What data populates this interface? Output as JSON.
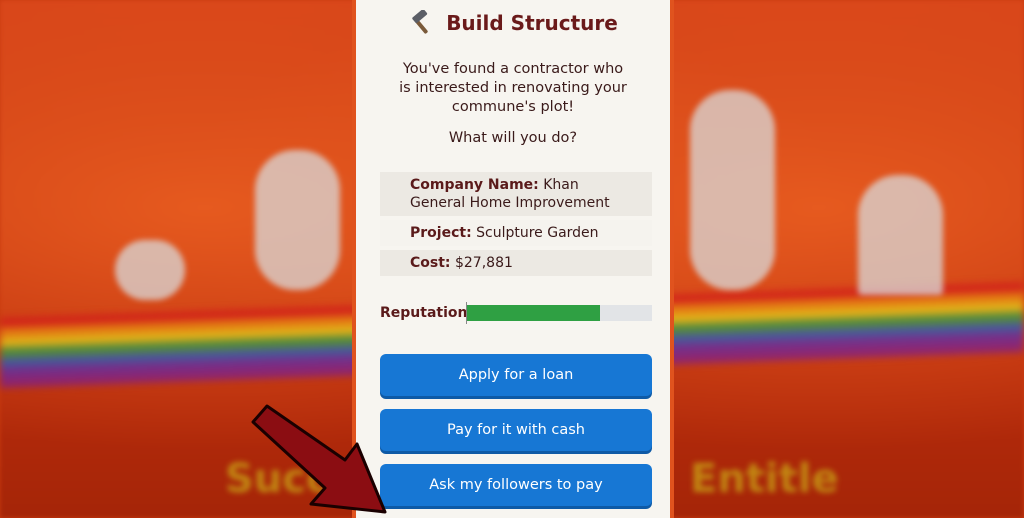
{
  "dialog": {
    "title": "Build Structure",
    "icon": "hammer-icon",
    "message": "You've found a contractor who is interested in renovating your commune's plot!",
    "question": "What will you do?",
    "details": [
      {
        "label": "Company Name:",
        "value": "Khan General Home Improvement"
      },
      {
        "label": "Project:",
        "value": "Sculpture Garden"
      },
      {
        "label": "Cost:",
        "value": "$27,881"
      }
    ],
    "reputation": {
      "label": "Reputation",
      "value_percent": 72,
      "color": "#2fa043"
    },
    "buttons": [
      {
        "label": "Apply for a loan"
      },
      {
        "label": "Pay for it with cash"
      },
      {
        "label": "Ask my followers to pay"
      }
    ],
    "accent_color": "#1777d4",
    "pointer_arrow_color": "#8b0d12"
  },
  "background": {
    "left_text": "Succe",
    "right_text": "Entitle"
  }
}
